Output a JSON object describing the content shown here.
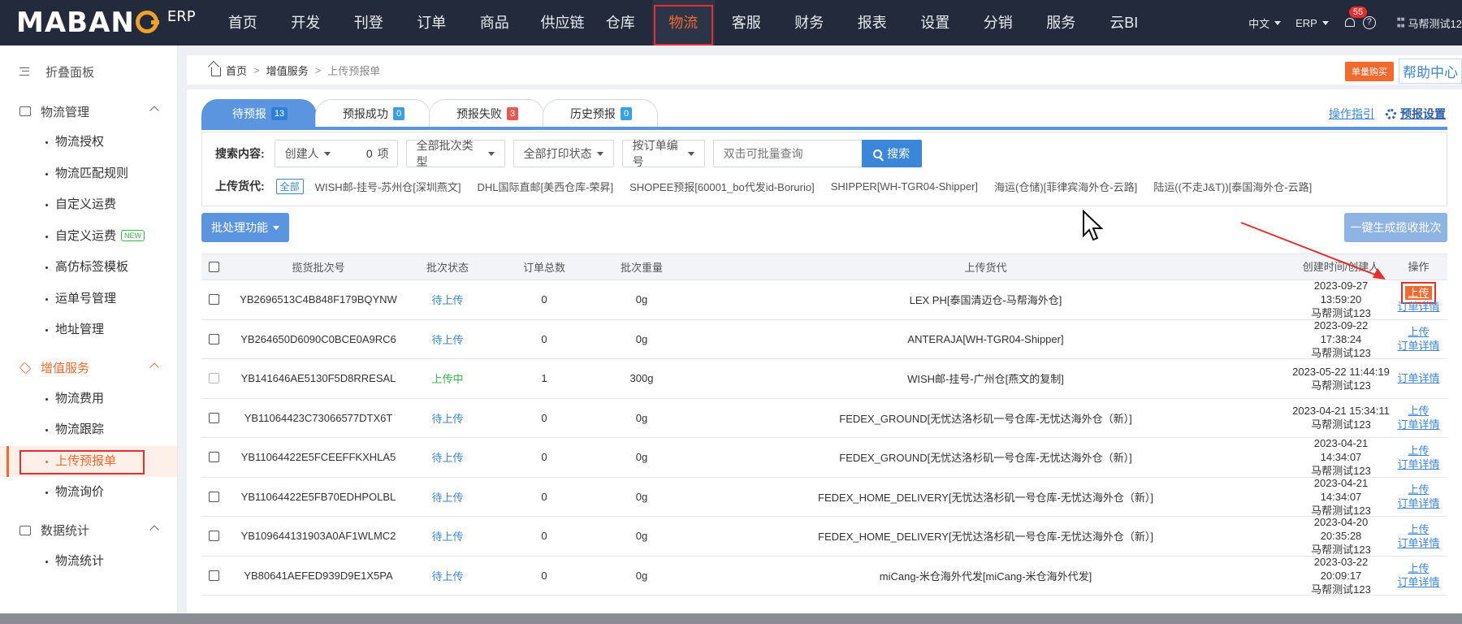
{
  "app": {
    "logo": "MABANG",
    "logo_suffix": "ERP"
  },
  "nav": {
    "items": [
      "首页",
      "开发",
      "刊登",
      "订单",
      "商品",
      "供应链",
      "仓库",
      "物流",
      "客服",
      "财务",
      "报表",
      "设置",
      "分销",
      "服务",
      "云BI"
    ],
    "active_index": 7
  },
  "top_right": {
    "language": "中文",
    "erp": "ERP",
    "notifications": "55",
    "help_icon": "?",
    "user": "马帮测试12"
  },
  "sidebar": {
    "collapse": "折叠面板",
    "groups": [
      {
        "label": "物流管理",
        "icon": "truck-icon",
        "items": [
          "物流授权",
          "物流匹配规则",
          "自定义运费",
          "自定义运费",
          "高仿标签模板",
          "运单号管理",
          "地址管理"
        ]
      },
      {
        "label": "增值服务",
        "icon": "diamond-icon",
        "items": [
          "物流费用",
          "物流跟踪",
          "上传预报单",
          "物流询价"
        ]
      },
      {
        "label": "数据统计",
        "icon": "grid-icon",
        "items": [
          "物流统计"
        ]
      }
    ],
    "new_tag": "NEW",
    "active_item": "上传预报单"
  },
  "breadcrumb": {
    "home": "首页",
    "parent": "增值服务",
    "current": "上传预报单",
    "buy_button": "单量购买",
    "help_center": "帮助中心"
  },
  "tabs": [
    {
      "label": "待预报",
      "count": "13",
      "color": "blue"
    },
    {
      "label": "预报成功",
      "count": "0",
      "color": "blue"
    },
    {
      "label": "预报失败",
      "count": "3",
      "color": "red"
    },
    {
      "label": "历史预报",
      "count": "0",
      "color": "blue"
    }
  ],
  "ops_links": {
    "guide": "操作指引",
    "settings": "预报设置"
  },
  "search": {
    "label": "搜索内容:",
    "creator": "创建人",
    "creator_count": "0",
    "creator_unit": "项",
    "batch_type": "全部批次类型",
    "print_status": "全部打印状态",
    "order_no": "按订单编号",
    "placeholder": "双击可批量查询",
    "button": "搜索"
  },
  "carriers": {
    "label": "上传货代:",
    "all": "全部",
    "items": [
      "WISH邮-挂号-苏州仓[深圳燕文]",
      "DHL国际直邮[美西仓库-荣昇]",
      "SHOPEE预报[60001_bo代发id-Borurio]",
      "SHIPPER[WH-TGR04-Shipper]",
      "海运(仓储)[菲律宾海外仓-云路]",
      "陆运((不走J&T))[泰国海外仓-云路]"
    ]
  },
  "actions": {
    "bulk": "批处理功能",
    "generate": "一键生成揽收批次"
  },
  "table": {
    "headers": [
      "揽货批次号",
      "批次状态",
      "订单总数",
      "批次重量",
      "上传货代",
      "创建时间/创建人",
      "操作"
    ],
    "rows": [
      {
        "batch": "YB2696513C4B848F179BQYNW",
        "status": "待上传",
        "orders": "0",
        "weight": "0g",
        "carrier": "LEX PH[泰国清迈仓-马帮海外仓]",
        "time": "2023-09-27 13:59:20",
        "creator": "马帮测试123",
        "upload": "上传",
        "detail": "订单详情",
        "disabled": false
      },
      {
        "batch": "YB264650D6090C0BCE0A9RC6",
        "status": "待上传",
        "orders": "0",
        "weight": "0g",
        "carrier": "ANTERAJA[WH-TGR04-Shipper]",
        "time": "2023-09-22 17:38:24",
        "creator": "马帮测试123",
        "upload": "上传",
        "detail": "订单详情",
        "disabled": false
      },
      {
        "batch": "YB141646AE5130F5D8RRESAL",
        "status": "上传中",
        "orders": "1",
        "weight": "300g",
        "carrier": "WISH邮-挂号-广州仓[燕文的复制]",
        "time": "2023-05-22 11:44:19",
        "creator": "马帮测试123",
        "upload": "",
        "detail": "订单详情",
        "disabled": true
      },
      {
        "batch": "YB11064423C73066577DTX6T",
        "status": "待上传",
        "orders": "0",
        "weight": "0g",
        "carrier": "FEDEX_GROUND[无忧达洛杉矶一号仓库-无忧达海外仓（新）]",
        "time": "2023-04-21 15:34:11",
        "creator": "马帮测试123",
        "upload": "上传",
        "detail": "订单详情",
        "disabled": false
      },
      {
        "batch": "YB11064422E5FCEEFFKXHLA5",
        "status": "待上传",
        "orders": "0",
        "weight": "0g",
        "carrier": "FEDEX_GROUND[无忧达洛杉矶一号仓库-无忧达海外仓（新）]",
        "time": "2023-04-21 14:34:07",
        "creator": "马帮测试123",
        "upload": "上传",
        "detail": "订单详情",
        "disabled": false
      },
      {
        "batch": "YB11064422E5FB70EDHPOLBL",
        "status": "待上传",
        "orders": "0",
        "weight": "0g",
        "carrier": "FEDEX_HOME_DELIVERY[无忧达洛杉矶一号仓库-无忧达海外仓（新）]",
        "time": "2023-04-21 14:34:07",
        "creator": "马帮测试123",
        "upload": "上传",
        "detail": "订单详情",
        "disabled": false
      },
      {
        "batch": "YB109644131903A0AF1WLMC2",
        "status": "待上传",
        "orders": "0",
        "weight": "0g",
        "carrier": "FEDEX_HOME_DELIVERY[无忧达洛杉矶一号仓库-无忧达海外仓（新）]",
        "time": "2023-04-20 20:35:28",
        "creator": "马帮测试123",
        "upload": "上传",
        "detail": "订单详情",
        "disabled": false
      },
      {
        "batch": "YB80641AEFED939D9E1X5PA",
        "status": "待上传",
        "orders": "0",
        "weight": "0g",
        "carrier": "miCang-米仓海外代发[miCang-米仓海外代发]",
        "time": "2023-03-22 20:09:17",
        "creator": "马帮测试123",
        "upload": "上传",
        "detail": "订单详情",
        "disabled": false
      }
    ]
  },
  "colors": {
    "nav_bg": "#232a3b",
    "accent_orange": "#f26a2e",
    "primary_blue": "#3a86d9",
    "tab_active": "#5b95e0",
    "highlight_red": "#e62e2e"
  }
}
